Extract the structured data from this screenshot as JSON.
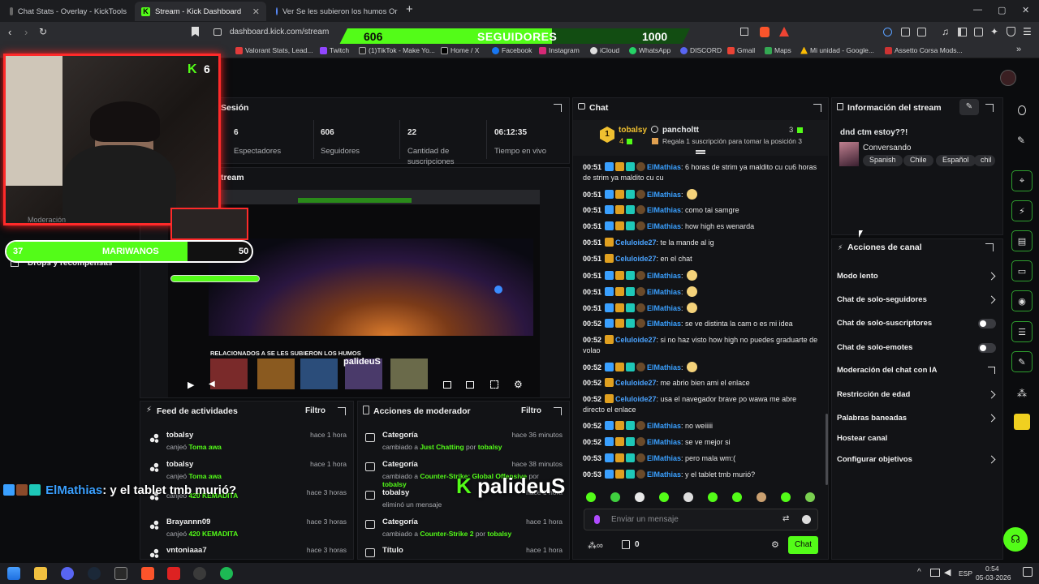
{
  "browser": {
    "tabs": [
      {
        "title": "Chat Stats - Overlay - KickTools"
      },
      {
        "title": "Stream - Kick Dashboard"
      },
      {
        "title": "Ver Se les subieron los humos Or"
      }
    ],
    "url": "dashboard.kick.com/stream",
    "bookmarks": [
      "Valorant Stats, Lead...",
      "Twitch",
      "(1)TikTok - Make Yo...",
      "Home / X",
      "Facebook",
      "Instagram",
      "iCloud",
      "WhatsApp",
      "DISCORD",
      "Gmail",
      "Maps",
      "Mi unidad - Google...",
      "Assetto Corsa Mods..."
    ]
  },
  "overlay": {
    "follow_goal": {
      "current": "606",
      "label": "SEGUIDORES",
      "target": "1000",
      "progress": 0.606
    },
    "sub_goal": {
      "current": "37",
      "label": "MARIWANOS",
      "target": "50",
      "progress": 0.74
    },
    "cam_badge": "6",
    "cam_logo": "K",
    "chat_overlay": {
      "user": "ElMathias",
      "message": ": y el tablet tmb murió?"
    },
    "watermark": "palideuS"
  },
  "session": {
    "title": "Sesión",
    "stats": [
      {
        "value": "6",
        "label": "Espectadores"
      },
      {
        "value": "606",
        "label": "Seguidores"
      },
      {
        "value": "22",
        "label": "Cantidad de suscripciones"
      },
      {
        "value": "06:12:35",
        "label": "Tiempo en vivo"
      }
    ],
    "stream_title": "tream"
  },
  "sidebar_partial": {
    "moderation": "Moderación",
    "drops": "Drops y recompensas"
  },
  "preview": {
    "section_label": "RELACIONADOS A SE LES SUBIERON LOS HUMOS",
    "channel": "palideuS"
  },
  "activity_feed": {
    "title": "Feed de actividades",
    "filter": "Filtro",
    "items": [
      {
        "user": "tobalsy",
        "action": "canjeó",
        "item": "Toma awa",
        "time": "hace 1 hora"
      },
      {
        "user": "tobalsy",
        "action": "canjeó",
        "item": "Toma awa",
        "time": "hace 1 hora"
      },
      {
        "user": "",
        "action": "canjeó",
        "item": "420 KEMADITA",
        "time": "hace 3 horas"
      },
      {
        "user": "Brayannn09",
        "action": "canjeó",
        "item": "420 KEMADITA",
        "time": "hace 3 horas"
      },
      {
        "user": "vntoniaaa7",
        "action": "",
        "item": "",
        "time": "hace 3 horas"
      }
    ]
  },
  "mod_actions": {
    "title": "Acciones de moderador",
    "filter": "Filtro",
    "items": [
      {
        "head": "Categoría",
        "pre": "cambiado a",
        "value": "Just Chatting",
        "by": "por",
        "user": "tobalsy",
        "time": "hace 36 minutos"
      },
      {
        "head": "Categoría",
        "pre": "cambiado a",
        "value": "Counter-Strike: Global Offensive",
        "by": "por",
        "user": "tobalsy",
        "time": "hace 38 minutos"
      },
      {
        "head": "tobalsy",
        "pre": "eliminó un mensaje",
        "value": "",
        "by": "",
        "user": "",
        "time": "hace 1 hora"
      },
      {
        "head": "Categoría",
        "pre": "cambiado a",
        "value": "Counter-Strike 2",
        "by": "por",
        "user": "tobalsy",
        "time": "hace 1 hora"
      },
      {
        "head": "Título",
        "pre": "",
        "value": "",
        "by": "",
        "user": "",
        "time": "hace 1 hora"
      }
    ]
  },
  "chat": {
    "title": "Chat",
    "pinned": {
      "rank": "1",
      "user1": "tobalsy",
      "count1": "4",
      "user2": "pancholtt",
      "count2": "3",
      "text": "Regala 1 suscripción para tomar la posición 3"
    },
    "messages": [
      {
        "time": "00:51",
        "user": "ElMathias",
        "text": ": 6 horas de strim ya maldito cu cu6 horas de strim ya maldito cu cu",
        "kind": "mathias"
      },
      {
        "time": "00:51",
        "user": "ElMathias",
        "text": ":",
        "kind": "mathias",
        "emote": true
      },
      {
        "time": "00:51",
        "user": "ElMathias",
        "text": ": como tai samgre",
        "kind": "mathias"
      },
      {
        "time": "00:51",
        "user": "ElMathias",
        "text": ": how high es wenarda",
        "kind": "mathias"
      },
      {
        "time": "00:51",
        "user": "Celuloide27",
        "text": ": te la mande al ig",
        "kind": "celu"
      },
      {
        "time": "00:51",
        "user": "Celuloide27",
        "text": ": en el chat",
        "kind": "celu"
      },
      {
        "time": "00:51",
        "user": "ElMathias",
        "text": ":",
        "kind": "mathias",
        "emote": true
      },
      {
        "time": "00:51",
        "user": "ElMathias",
        "text": ":",
        "kind": "mathias",
        "emote": true
      },
      {
        "time": "00:51",
        "user": "ElMathias",
        "text": ":",
        "kind": "mathias",
        "emote": true
      },
      {
        "time": "00:52",
        "user": "ElMathias",
        "text": ": se ve distinta la cam o es mi idea",
        "kind": "mathias"
      },
      {
        "time": "00:52",
        "user": "Celuloide27",
        "text": ": si no haz visto how high no puedes graduarte de volao",
        "kind": "celu"
      },
      {
        "time": "00:52",
        "user": "ElMathias",
        "text": ":",
        "kind": "mathias",
        "emote": true
      },
      {
        "time": "00:52",
        "user": "Celuloide27",
        "text": ": me abrio bien ami el enlace",
        "kind": "celu"
      },
      {
        "time": "00:52",
        "user": "Celuloide27",
        "text": ": usa el navegador brave po wawa me abre directo el enlace",
        "kind": "celu"
      },
      {
        "time": "00:52",
        "user": "ElMathias",
        "text": ": no weiiiii",
        "kind": "mathias"
      },
      {
        "time": "00:52",
        "user": "ElMathias",
        "text": ": se ve mejor si",
        "kind": "mathias"
      },
      {
        "time": "00:53",
        "user": "ElMathias",
        "text": ": pero mala wm:(",
        "kind": "mathias"
      },
      {
        "time": "00:53",
        "user": "ElMathias",
        "text": ": y el tablet tmb murió?",
        "kind": "mathias"
      }
    ],
    "input_placeholder": "Enviar un mensaje",
    "points": "0",
    "send": "Chat"
  },
  "stream_info": {
    "title": "Información del stream",
    "stream_title": "dnd ctm estoy??!",
    "category": "Conversando",
    "tags": [
      "Spanish",
      "Chile",
      "Español",
      "chil"
    ]
  },
  "channel_actions": {
    "title": "Acciones de canal",
    "rows": [
      {
        "label": "Modo lento",
        "control": "chevron"
      },
      {
        "label": "Chat de solo-seguidores",
        "control": "chevron"
      },
      {
        "label": "Chat de solo-suscriptores",
        "control": "toggle"
      },
      {
        "label": "Chat de solo-emotes",
        "control": "toggle"
      },
      {
        "label": "Moderación del chat con IA",
        "control": "link"
      },
      {
        "label": "Restricción de edad",
        "control": "chevron"
      },
      {
        "label": "Palabras baneadas",
        "control": "chevron"
      },
      {
        "label": "Hostear canal",
        "control": "none"
      },
      {
        "label": "Configurar objetivos",
        "control": "chevron"
      }
    ]
  },
  "taskbar": {
    "lang": "ESP",
    "time": "0:54",
    "date": "05-03-2026"
  },
  "colors": {
    "kick_green": "#53fc18",
    "mathias_blue": "#3aa0ff",
    "celu_blue": "#4aa3ff",
    "panel_bg": "#121316"
  }
}
